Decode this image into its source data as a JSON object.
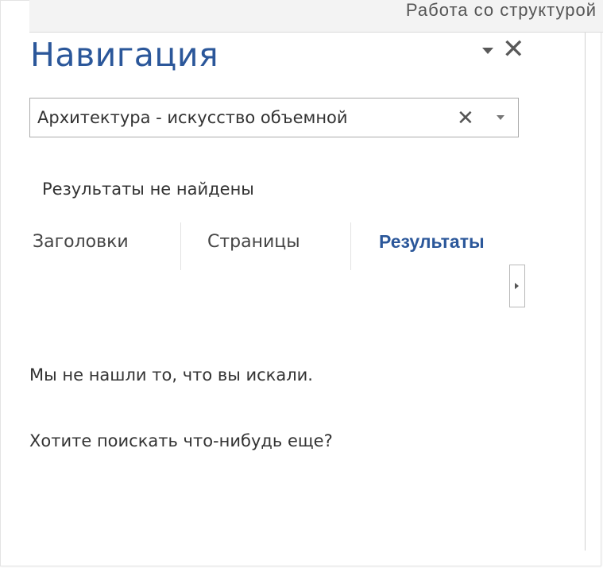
{
  "ribbon": {
    "text": "Работа со структурой"
  },
  "pane": {
    "title": "Навигация",
    "menu_icon": "chevron-down-icon",
    "close_icon": "close-icon",
    "close_glyph": "✕"
  },
  "search": {
    "value": "Архитектура - искусство объемной",
    "clear_glyph": "✕"
  },
  "status": {
    "no_results": "Результаты не найдены"
  },
  "tabs": [
    {
      "label": "Заголовки"
    },
    {
      "label": "Страницы"
    },
    {
      "label": "Результаты"
    }
  ],
  "results": {
    "message": "Мы не нашли то, что вы искали.",
    "suggestion": "Хотите поискать что-нибудь еще?"
  },
  "colors": {
    "accent": "#2b579a",
    "text": "#333333",
    "border": "#ababab"
  }
}
